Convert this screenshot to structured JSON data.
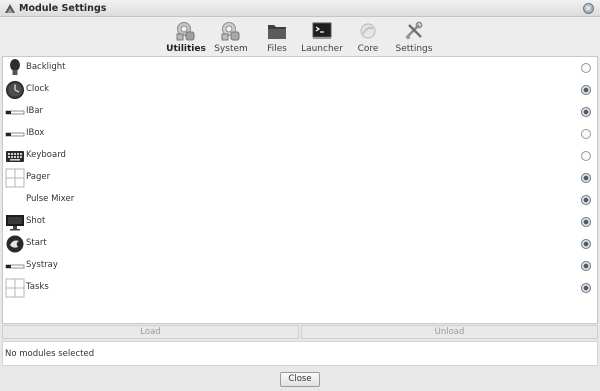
{
  "window": {
    "title": "Module Settings",
    "close_glyph": "×"
  },
  "toolbar": [
    {
      "label": "Utilities",
      "icon": "utilities-icon",
      "active": true
    },
    {
      "label": "System",
      "icon": "system-icon"
    },
    {
      "label": "Files",
      "icon": "files-icon"
    },
    {
      "label": "Launcher",
      "icon": "launcher-icon"
    },
    {
      "label": "Core",
      "icon": "core-icon"
    },
    {
      "label": "Settings",
      "icon": "settings-icon"
    }
  ],
  "modules": [
    {
      "label": "Backlight",
      "icon": "bulb-icon",
      "loaded": false
    },
    {
      "label": "Clock",
      "icon": "clock-icon",
      "loaded": true
    },
    {
      "label": "IBar",
      "icon": "ibar-icon",
      "loaded": true
    },
    {
      "label": "IBox",
      "icon": "ibox-icon",
      "loaded": false
    },
    {
      "label": "Keyboard",
      "icon": "keyboard-icon",
      "loaded": false
    },
    {
      "label": "Pager",
      "icon": "pager-icon",
      "loaded": true
    },
    {
      "label": "Pulse Mixer",
      "icon": "",
      "loaded": true
    },
    {
      "label": "Shot",
      "icon": "monitor-icon",
      "loaded": true
    },
    {
      "label": "Start",
      "icon": "start-icon",
      "loaded": true
    },
    {
      "label": "Systray",
      "icon": "systray-icon",
      "loaded": true
    },
    {
      "label": "Tasks",
      "icon": "tasks-icon",
      "loaded": true
    }
  ],
  "actions": {
    "load": "Load",
    "unload": "Unload"
  },
  "info": "No modules selected",
  "footer": {
    "close": "Close"
  }
}
